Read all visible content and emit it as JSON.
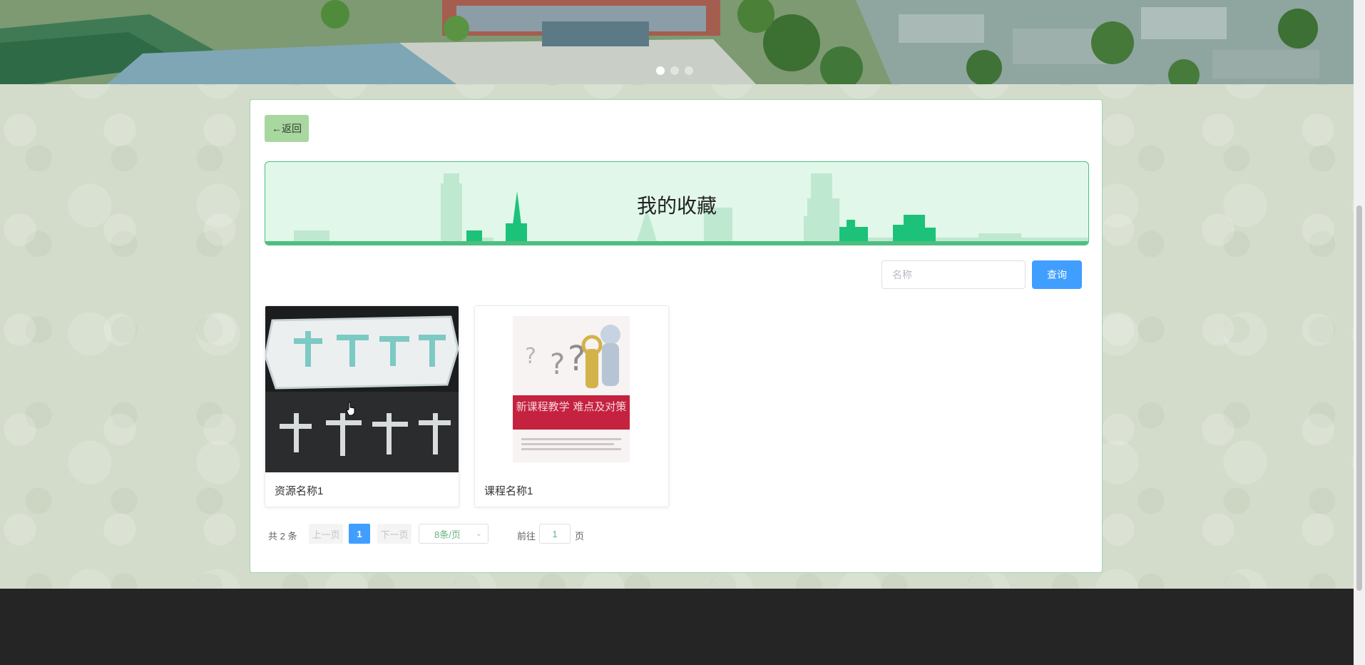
{
  "banner": {
    "slide_count": 3,
    "active_slide": 1
  },
  "card": {
    "back_label": "←返回",
    "title": "我的收藏",
    "search": {
      "placeholder": "名称",
      "value": ""
    },
    "search_button": "查询"
  },
  "items": [
    {
      "name": "资源名称1",
      "image_icon": "seal-carving-image"
    },
    {
      "name": "课程名称1",
      "image_icon": "book-cover-image",
      "cover_text": "新课程教学 难点及对策"
    }
  ],
  "pagination": {
    "total": "共 2 条",
    "prev": "上一页",
    "current": "1",
    "next": "下一页",
    "page_size": "8条/页",
    "goto_label": "前往",
    "goto_value": "1",
    "page_label": "页"
  },
  "colors": {
    "accent": "#409eff",
    "back_button": "#a9d7a0",
    "title_box": "#e1f7e9",
    "title_border": "#4dbf7f",
    "footer": "#252525"
  }
}
